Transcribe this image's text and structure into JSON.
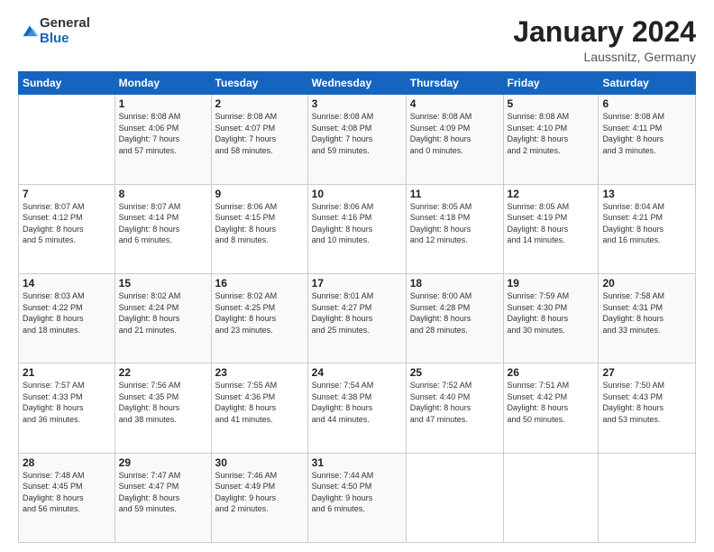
{
  "logo": {
    "general": "General",
    "blue": "Blue"
  },
  "title": "January 2024",
  "subtitle": "Laussnitz, Germany",
  "days_header": [
    "Sunday",
    "Monday",
    "Tuesday",
    "Wednesday",
    "Thursday",
    "Friday",
    "Saturday"
  ],
  "weeks": [
    [
      {
        "num": "",
        "info": ""
      },
      {
        "num": "1",
        "info": "Sunrise: 8:08 AM\nSunset: 4:06 PM\nDaylight: 7 hours\nand 57 minutes."
      },
      {
        "num": "2",
        "info": "Sunrise: 8:08 AM\nSunset: 4:07 PM\nDaylight: 7 hours\nand 58 minutes."
      },
      {
        "num": "3",
        "info": "Sunrise: 8:08 AM\nSunset: 4:08 PM\nDaylight: 7 hours\nand 59 minutes."
      },
      {
        "num": "4",
        "info": "Sunrise: 8:08 AM\nSunset: 4:09 PM\nDaylight: 8 hours\nand 0 minutes."
      },
      {
        "num": "5",
        "info": "Sunrise: 8:08 AM\nSunset: 4:10 PM\nDaylight: 8 hours\nand 2 minutes."
      },
      {
        "num": "6",
        "info": "Sunrise: 8:08 AM\nSunset: 4:11 PM\nDaylight: 8 hours\nand 3 minutes."
      }
    ],
    [
      {
        "num": "7",
        "info": "Sunrise: 8:07 AM\nSunset: 4:12 PM\nDaylight: 8 hours\nand 5 minutes."
      },
      {
        "num": "8",
        "info": "Sunrise: 8:07 AM\nSunset: 4:14 PM\nDaylight: 8 hours\nand 6 minutes."
      },
      {
        "num": "9",
        "info": "Sunrise: 8:06 AM\nSunset: 4:15 PM\nDaylight: 8 hours\nand 8 minutes."
      },
      {
        "num": "10",
        "info": "Sunrise: 8:06 AM\nSunset: 4:16 PM\nDaylight: 8 hours\nand 10 minutes."
      },
      {
        "num": "11",
        "info": "Sunrise: 8:05 AM\nSunset: 4:18 PM\nDaylight: 8 hours\nand 12 minutes."
      },
      {
        "num": "12",
        "info": "Sunrise: 8:05 AM\nSunset: 4:19 PM\nDaylight: 8 hours\nand 14 minutes."
      },
      {
        "num": "13",
        "info": "Sunrise: 8:04 AM\nSunset: 4:21 PM\nDaylight: 8 hours\nand 16 minutes."
      }
    ],
    [
      {
        "num": "14",
        "info": "Sunrise: 8:03 AM\nSunset: 4:22 PM\nDaylight: 8 hours\nand 18 minutes."
      },
      {
        "num": "15",
        "info": "Sunrise: 8:02 AM\nSunset: 4:24 PM\nDaylight: 8 hours\nand 21 minutes."
      },
      {
        "num": "16",
        "info": "Sunrise: 8:02 AM\nSunset: 4:25 PM\nDaylight: 8 hours\nand 23 minutes."
      },
      {
        "num": "17",
        "info": "Sunrise: 8:01 AM\nSunset: 4:27 PM\nDaylight: 8 hours\nand 25 minutes."
      },
      {
        "num": "18",
        "info": "Sunrise: 8:00 AM\nSunset: 4:28 PM\nDaylight: 8 hours\nand 28 minutes."
      },
      {
        "num": "19",
        "info": "Sunrise: 7:59 AM\nSunset: 4:30 PM\nDaylight: 8 hours\nand 30 minutes."
      },
      {
        "num": "20",
        "info": "Sunrise: 7:58 AM\nSunset: 4:31 PM\nDaylight: 8 hours\nand 33 minutes."
      }
    ],
    [
      {
        "num": "21",
        "info": "Sunrise: 7:57 AM\nSunset: 4:33 PM\nDaylight: 8 hours\nand 36 minutes."
      },
      {
        "num": "22",
        "info": "Sunrise: 7:56 AM\nSunset: 4:35 PM\nDaylight: 8 hours\nand 38 minutes."
      },
      {
        "num": "23",
        "info": "Sunrise: 7:55 AM\nSunset: 4:36 PM\nDaylight: 8 hours\nand 41 minutes."
      },
      {
        "num": "24",
        "info": "Sunrise: 7:54 AM\nSunset: 4:38 PM\nDaylight: 8 hours\nand 44 minutes."
      },
      {
        "num": "25",
        "info": "Sunrise: 7:52 AM\nSunset: 4:40 PM\nDaylight: 8 hours\nand 47 minutes."
      },
      {
        "num": "26",
        "info": "Sunrise: 7:51 AM\nSunset: 4:42 PM\nDaylight: 8 hours\nand 50 minutes."
      },
      {
        "num": "27",
        "info": "Sunrise: 7:50 AM\nSunset: 4:43 PM\nDaylight: 8 hours\nand 53 minutes."
      }
    ],
    [
      {
        "num": "28",
        "info": "Sunrise: 7:48 AM\nSunset: 4:45 PM\nDaylight: 8 hours\nand 56 minutes."
      },
      {
        "num": "29",
        "info": "Sunrise: 7:47 AM\nSunset: 4:47 PM\nDaylight: 8 hours\nand 59 minutes."
      },
      {
        "num": "30",
        "info": "Sunrise: 7:46 AM\nSunset: 4:49 PM\nDaylight: 9 hours\nand 2 minutes."
      },
      {
        "num": "31",
        "info": "Sunrise: 7:44 AM\nSunset: 4:50 PM\nDaylight: 9 hours\nand 6 minutes."
      },
      {
        "num": "",
        "info": ""
      },
      {
        "num": "",
        "info": ""
      },
      {
        "num": "",
        "info": ""
      }
    ]
  ]
}
